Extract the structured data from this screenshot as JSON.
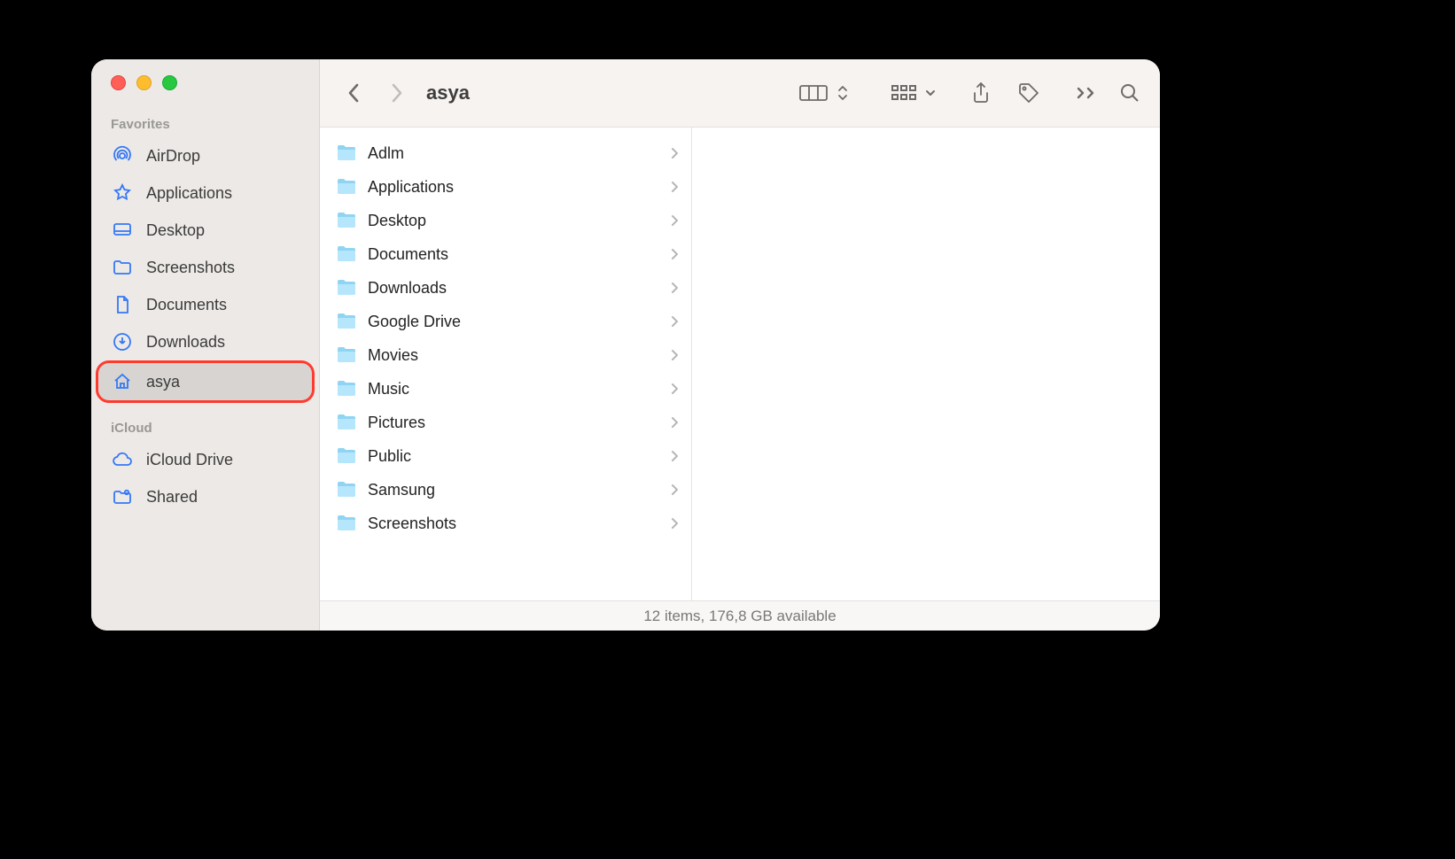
{
  "window_title": "asya",
  "sidebar": {
    "sections": [
      {
        "label": "Favorites",
        "items": [
          {
            "icon": "airdrop",
            "label": "AirDrop"
          },
          {
            "icon": "applications",
            "label": "Applications"
          },
          {
            "icon": "desktop",
            "label": "Desktop"
          },
          {
            "icon": "folder",
            "label": "Screenshots"
          },
          {
            "icon": "documents",
            "label": "Documents"
          },
          {
            "icon": "downloads",
            "label": "Downloads"
          },
          {
            "icon": "home",
            "label": "asya",
            "selected": true,
            "highlighted": true
          }
        ]
      },
      {
        "label": "iCloud",
        "items": [
          {
            "icon": "icloud",
            "label": "iCloud Drive"
          },
          {
            "icon": "shared",
            "label": "Shared"
          }
        ]
      }
    ]
  },
  "folders": [
    {
      "name": "Adlm"
    },
    {
      "name": "Applications"
    },
    {
      "name": "Desktop"
    },
    {
      "name": "Documents"
    },
    {
      "name": "Downloads"
    },
    {
      "name": "Google Drive"
    },
    {
      "name": "Movies"
    },
    {
      "name": "Music"
    },
    {
      "name": "Pictures"
    },
    {
      "name": "Public"
    },
    {
      "name": "Samsung"
    },
    {
      "name": "Screenshots"
    }
  ],
  "status_bar": "12 items, 176,8 GB available"
}
